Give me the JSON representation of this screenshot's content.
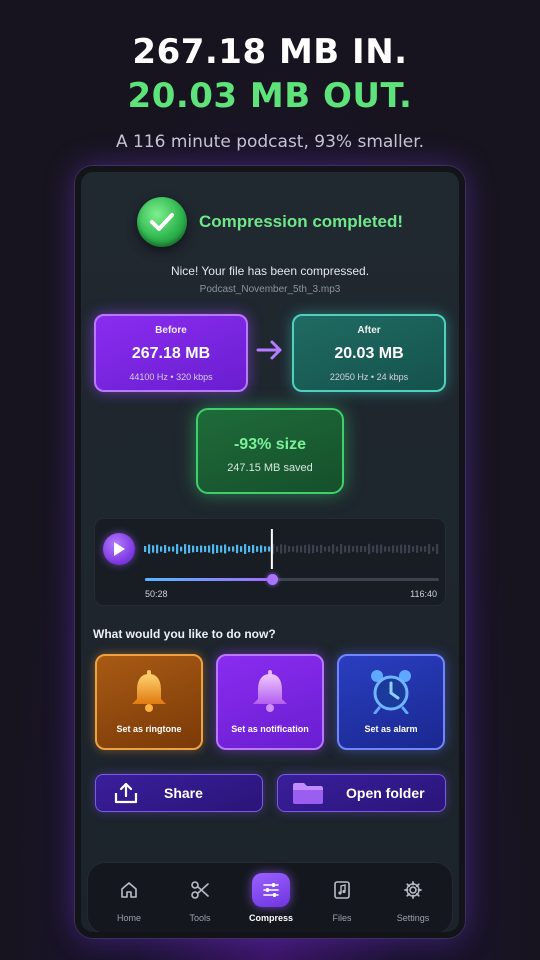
{
  "hero": {
    "line1": "267.18 MB IN.",
    "line2": "20.03 MB OUT.",
    "subtitle": "A 116 minute podcast, 93% smaller."
  },
  "status": {
    "title": "Compression completed!",
    "message": "Nice! Your file has been compressed.",
    "filename": "Podcast_November_5th_3.mp3"
  },
  "before": {
    "label": "Before",
    "size": "267.18 MB",
    "meta": "44100 Hz • 320 kbps"
  },
  "after": {
    "label": "After",
    "size": "20.03 MB",
    "meta": "22050 Hz • 24 kbps"
  },
  "saving": {
    "percent": "-93% size",
    "saved": "247.15 MB saved"
  },
  "player": {
    "current_time": "50:28",
    "total_time": "116:40",
    "progress": 0.432
  },
  "actions": {
    "question": "What would you like to do now?",
    "ringtone": "Set as ringtone",
    "notification": "Set as notification",
    "alarm": "Set as alarm",
    "share": "Share",
    "open_folder": "Open folder"
  },
  "nav": {
    "items": [
      {
        "label": "Home",
        "icon": "home-icon"
      },
      {
        "label": "Tools",
        "icon": "scissors-icon"
      },
      {
        "label": "Compress",
        "icon": "sliders-icon",
        "active": true
      },
      {
        "label": "Files",
        "icon": "music-file-icon"
      },
      {
        "label": "Settings",
        "icon": "gear-icon"
      }
    ]
  },
  "colors": {
    "accent_green": "#5ee27a",
    "accent_purple": "#8a2cf0",
    "accent_teal": "#4fd1bf",
    "accent_orange": "#f0a240",
    "accent_blue": "#6f86ff"
  }
}
